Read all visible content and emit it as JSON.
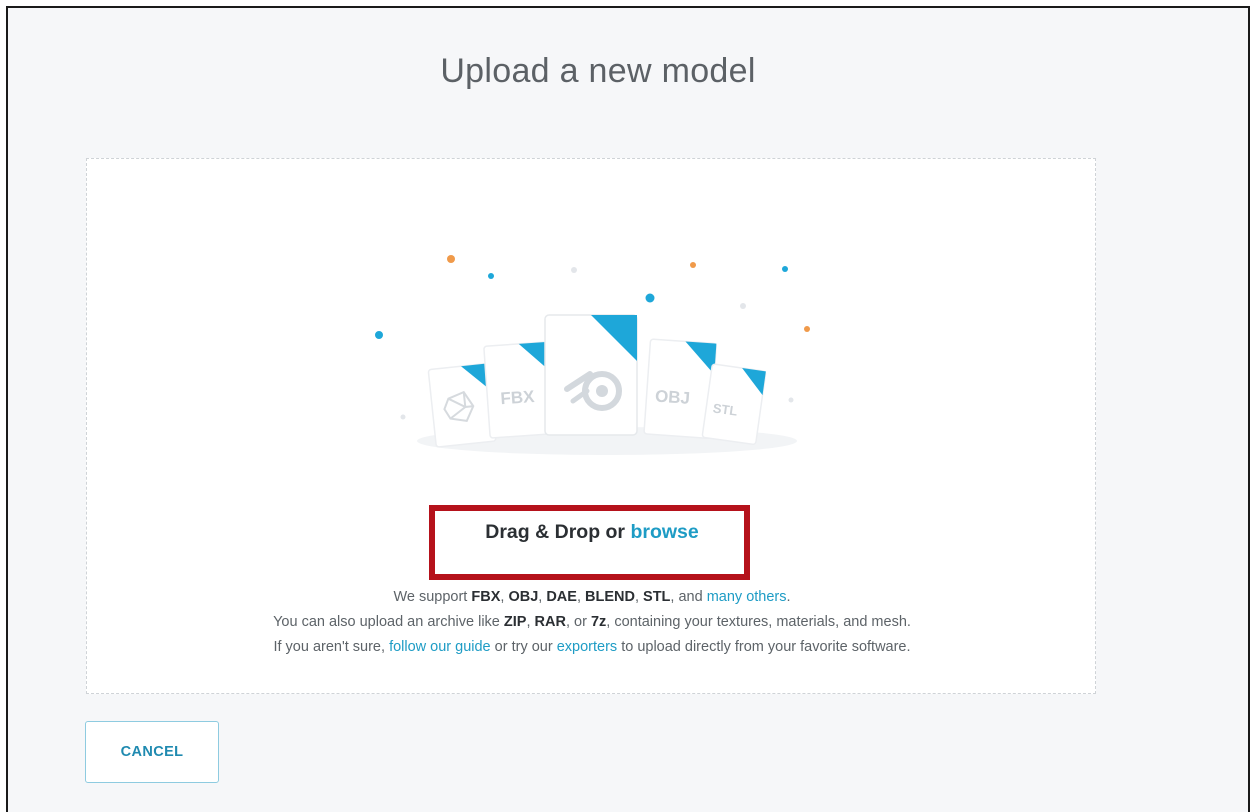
{
  "dialog": {
    "title": "Upload a new model"
  },
  "dropzone": {
    "illustration": {
      "file_labels": [
        "FBX",
        "OBJ",
        "STL"
      ],
      "icons": [
        "unity-logo-icon",
        "blender-logo-icon"
      ],
      "accent_colors": {
        "blue": "#1ea7d9",
        "orange": "#f09a4a",
        "grey": "#dfe2e6"
      }
    },
    "drag_drop_text": "Drag & Drop or",
    "browse_link": "browse",
    "info": {
      "line1_prefix": "We support",
      "formats": [
        "FBX",
        "OBJ",
        "DAE",
        "BLEND",
        "STL"
      ],
      "sep": ",",
      "line1_and": ", and",
      "many_others_link": "many others",
      "line1_end": ".",
      "line2_prefix": "You can also upload an archive like",
      "archives": [
        "ZIP",
        "RAR",
        "7z"
      ],
      "line2_or": ", or",
      "line2_suffix": ", containing your textures, materials, and mesh.",
      "line3_prefix": "If you aren't sure,",
      "guide_link": "follow our guide",
      "line3_mid": "or try our",
      "exporters_link": "exporters",
      "line3_suffix": "to upload directly from your favorite software."
    }
  },
  "footer": {
    "cancel_label": "CANCEL"
  },
  "colors": {
    "accent": "#1e9cc5",
    "highlight_box": "#b5121b",
    "page_bg": "#f6f7f9"
  }
}
